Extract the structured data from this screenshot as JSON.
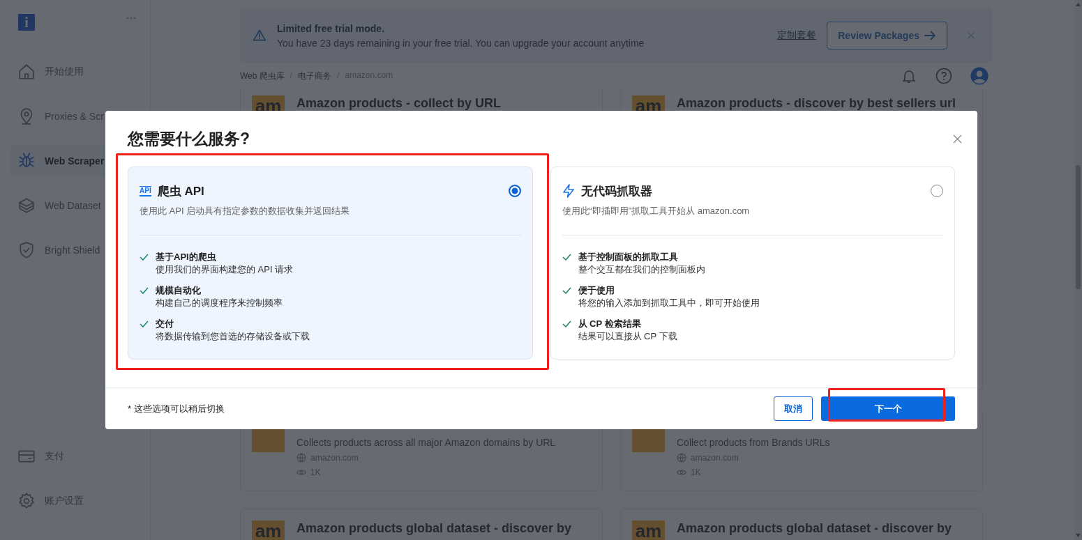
{
  "sidebar": {
    "logo": "i",
    "items": [
      {
        "label": "开始使用",
        "selected": false
      },
      {
        "label": "Proxies & Scr",
        "selected": false
      },
      {
        "label": "Web Scraper",
        "selected": true
      },
      {
        "label": "Web Dataset",
        "selected": false
      },
      {
        "label": "Bright Shield",
        "selected": false
      }
    ],
    "bottom_items": [
      {
        "label": "支付"
      },
      {
        "label": "账户设置"
      }
    ]
  },
  "banner": {
    "title": "Limited free trial mode.",
    "message": "You have 23 days remaining in your free trial. You can upgrade your account anytime",
    "link": "定制套餐",
    "button": "Review Packages"
  },
  "breadcrumb": {
    "separator": "/",
    "items": [
      "Web 爬虫库",
      "电子商务",
      "amazon.com"
    ]
  },
  "cards": [
    {
      "logo": "am",
      "title": "Amazon products - collect by URL"
    },
    {
      "logo": "am",
      "title": "Amazon products - discover by best sellers url"
    },
    {
      "description": "Collects products across all major Amazon domains by URL",
      "domain": "amazon.com",
      "views": "1K"
    },
    {
      "description": "Collect products from Brands URLs",
      "domain": "amazon.com",
      "views": "1K"
    },
    {
      "logo": "am",
      "title": "Amazon products global dataset - discover by"
    },
    {
      "logo": "am",
      "title": "Amazon products global dataset - discover by"
    }
  ],
  "modal": {
    "title": "您需要什么服务?",
    "options": [
      {
        "kind": "api",
        "badge": "API",
        "title": "爬虫 API",
        "description": "使用此 API 启动具有指定参数的数据收集并返回结果",
        "selected": true,
        "highlighted": true,
        "features": [
          {
            "title": "基于API的爬虫",
            "description": "使用我们的界面构建您的 API 请求"
          },
          {
            "title": "规模自动化",
            "description": "构建自己的调度程序来控制频率"
          },
          {
            "title": "交付",
            "description": "将数据传输到您首选的存储设备或下载"
          }
        ]
      },
      {
        "kind": "nocode",
        "title": "无代码抓取器",
        "description": "使用此“即插即用”抓取工具开始从 amazon.com",
        "selected": false,
        "highlighted": false,
        "features": [
          {
            "title": "基于控制面板的抓取工具",
            "description": "整个交互都在我们的控制面板内"
          },
          {
            "title": "便于使用",
            "description": "将您的输入添加到抓取工具中，即可开始使用"
          },
          {
            "title": "从 CP 检索结果",
            "description": "结果可以直接从 CP 下载"
          }
        ]
      }
    ],
    "note": "* 这些选项可以稍后切换",
    "cancel_button": {
      "label": "取消",
      "highlighted": false
    },
    "next_button": {
      "label": "下一个",
      "highlighted": true
    }
  }
}
